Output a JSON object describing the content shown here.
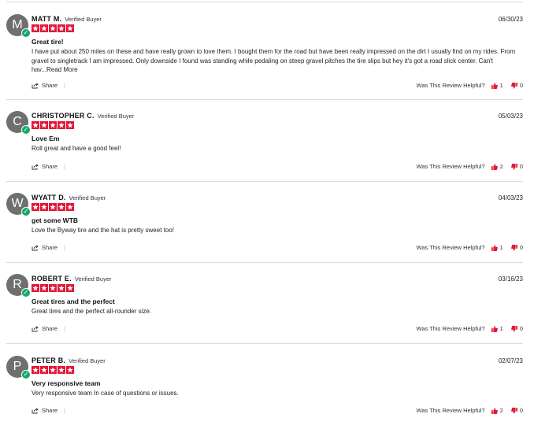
{
  "share_label": "Share",
  "helpful_label": "Was This Review Helpful?",
  "verified_label": "Verified Buyer",
  "colors": {
    "star": "#e31837",
    "verified": "#17a86a",
    "avatar": "#6f6f6f",
    "thumb": "#e31837"
  },
  "reviews": [
    {
      "initial": "M",
      "name": "MATT M.",
      "date": "06/30/23",
      "rating": 5,
      "title": "Great tire!",
      "body": "I have put about 250 miles on these and have really grown to love them. I bought them for the road but have been really impressed on the dirt I usually find on my rides. From gravel to singletrack I am impressed. Only downside I found was standing while pedaling on steep gravel pitches the tire slips but hey it's got a road slick center. Can't hav...",
      "read_more": "Read More",
      "up": "1",
      "down": "0"
    },
    {
      "initial": "C",
      "name": "CHRISTOPHER C.",
      "date": "05/03/23",
      "rating": 5,
      "title": "Love Em",
      "body": "Roll great and have a good feel!",
      "read_more": "",
      "up": "2",
      "down": "0"
    },
    {
      "initial": "W",
      "name": "WYATT D.",
      "date": "04/03/23",
      "rating": 5,
      "title": "get some WTB",
      "body": "Love the Byway tire and the hat is pretty sweet too!",
      "read_more": "",
      "up": "1",
      "down": "0"
    },
    {
      "initial": "R",
      "name": "ROBERT E.",
      "date": "03/16/23",
      "rating": 5,
      "title": "Great tires and the perfect",
      "body": "Great tires and the perfect all-rounder size.",
      "read_more": "",
      "up": "1",
      "down": "0"
    },
    {
      "initial": "P",
      "name": "PETER B.",
      "date": "02/07/23",
      "rating": 5,
      "title": "Very responsive team",
      "body": "Very responsive team In case of questions or issues.",
      "read_more": "",
      "up": "2",
      "down": "0"
    }
  ]
}
